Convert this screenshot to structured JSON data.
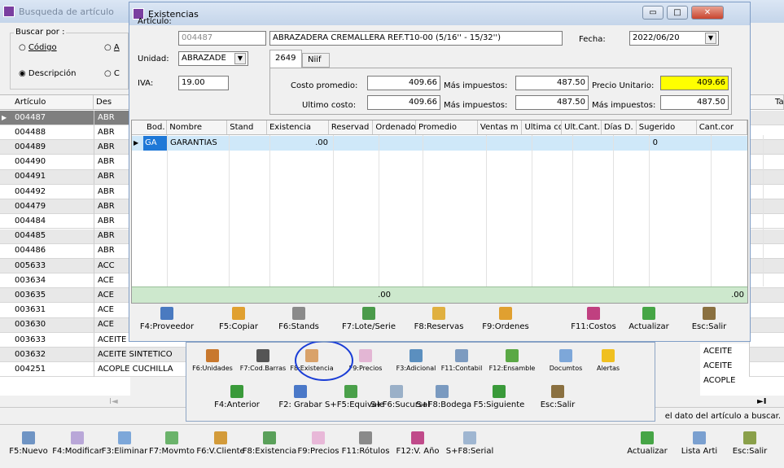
{
  "back_window": {
    "title": "Busqueda de artículo",
    "search_by_label": "Buscar por :",
    "radio_codigo": "Código",
    "radio_a": "A",
    "radio_descripcion": "Descripción",
    "radio_c": "C",
    "col_articulo": "Artículo",
    "col_des": "Des",
    "col_ta": "Ta",
    "rows": [
      {
        "code": "004487",
        "desc": "ABR",
        "extra": ""
      },
      {
        "code": "004488",
        "desc": "ABR",
        "extra": ""
      },
      {
        "code": "004489",
        "desc": "ABR",
        "extra": ""
      },
      {
        "code": "004490",
        "desc": "ABR",
        "extra": ""
      },
      {
        "code": "004491",
        "desc": "ABR",
        "extra": ""
      },
      {
        "code": "004492",
        "desc": "ABR",
        "extra": ""
      },
      {
        "code": "004479",
        "desc": "ABR",
        "extra": ""
      },
      {
        "code": "004484",
        "desc": "ABR",
        "extra": ""
      },
      {
        "code": "004485",
        "desc": "ABR",
        "extra": ""
      },
      {
        "code": "004486",
        "desc": "ABR",
        "extra": ""
      },
      {
        "code": "005633",
        "desc": "ACC",
        "extra": ""
      },
      {
        "code": "003634",
        "desc": "ACE",
        "extra": ""
      },
      {
        "code": "003635",
        "desc": "ACE",
        "extra": ""
      },
      {
        "code": "003631",
        "desc": "ACE",
        "extra": ""
      },
      {
        "code": "003630",
        "desc": "ACE",
        "extra": ""
      },
      {
        "code": "003633",
        "desc": "ACEITE CAPELLA W",
        "extra": "ACEITE"
      },
      {
        "code": "003632",
        "desc": "ACEITE SINTETICO",
        "extra": "ACEITE"
      },
      {
        "code": "004251",
        "desc": "ACOPLE CUCHILLA",
        "extra": "ACOPLE"
      }
    ],
    "nav_last": "►I",
    "nav_first": "I◄",
    "status_hint": "el dato del artículo a buscar."
  },
  "bottom_toolbar": [
    {
      "label": "F5:Nuevo",
      "color": "#6f94c4"
    },
    {
      "label": "F4:Modificar",
      "color": "#b9a7d8"
    },
    {
      "label": "F3:Eliminar",
      "color": "#7da7d9"
    },
    {
      "label": "F7:Movmto",
      "color": "#6bb36b"
    },
    {
      "label": "F6:V.Cliente",
      "color": "#d39b3a"
    },
    {
      "label": "F8:Existencia",
      "color": "#5aa05a"
    },
    {
      "label": "F9:Precios",
      "color": "#e8b8d8"
    },
    {
      "label": "F11:Rótulos",
      "color": "#8a8a8a"
    },
    {
      "label": "F12:V. Año",
      "color": "#c04a8a"
    },
    {
      "label": "S+F8:Serial",
      "color": "#9fb6d1"
    },
    {
      "label": "Actualizar",
      "color": "#46a546"
    },
    {
      "label": "Lista Arti",
      "color": "#7aa0d0"
    },
    {
      "label": "Esc:Salir",
      "color": "#8aa04a"
    }
  ],
  "middle_panel": {
    "row1": [
      {
        "label": "F6:Unidades",
        "color": "#c8782e"
      },
      {
        "label": "F7:Cod.Barras",
        "color": "#555555"
      },
      {
        "label": "F8:Existencia",
        "color": "#d9a26a"
      },
      {
        "label": "F9:Precios",
        "color": "#e3b6d4"
      },
      {
        "label": "F3:Adicional",
        "color": "#5b8fbf"
      },
      {
        "label": "F11:Contabil",
        "color": "#7d9bc0"
      },
      {
        "label": "F12:Ensamble",
        "color": "#5aa845"
      },
      {
        "label": "Documtos",
        "color": "#7da7d9"
      },
      {
        "label": "Alertas",
        "color": "#f0c020"
      }
    ],
    "row2": [
      {
        "label": "F4:Anterior",
        "color": "#3a9a3a"
      },
      {
        "label": "F2: Grabar",
        "color": "#4a78c8"
      },
      {
        "label": "S+F5:Equivale",
        "color": "#4aa04a"
      },
      {
        "label": "S+F6:Sucursal",
        "color": "#9ab0c8"
      },
      {
        "label": "S+F8:Bodega",
        "color": "#7a9ac0"
      },
      {
        "label": "F5:Siguiente",
        "color": "#3a9a3a"
      },
      {
        "label": "Esc:Salir",
        "color": "#8a7040"
      }
    ]
  },
  "existencias": {
    "title": "Existencias",
    "articulo_label": "Artículo:",
    "articulo_value": "004487",
    "description": "ABRAZADERA CREMALLERA REF.T10-00 (5/16'' - 15/32'')",
    "fecha_label": "Fecha:",
    "fecha_value": "2022/06/20",
    "unidad_label": "Unidad:",
    "unidad_value": "ABRAZADE",
    "tab_2649": "2649",
    "tab_niif": "Niif",
    "iva_label": "IVA:",
    "iva_value": "19.00",
    "costo_promedio_label": "Costo promedio:",
    "costo_promedio": "409.66",
    "mas_impuestos_label": "Más impuestos:",
    "costo_promedio_imp": "487.50",
    "precio_unitario_label": "Precio Unitario:",
    "precio_unitario": "409.66",
    "ultimo_costo_label": "Ultimo costo:",
    "ultimo_costo": "409.66",
    "ultimo_costo_imp": "487.50",
    "precio_imp": "487.50",
    "columns": [
      "Bod.",
      "Nombre",
      "Stand",
      "Existencia",
      "Reservad",
      "Ordenado",
      "Promedio",
      "Ventas m",
      "Ultima co",
      "Ult.Cant.",
      "Días D.",
      "Sugerido",
      "Cant.cor"
    ],
    "row": {
      "bod": "GA",
      "nombre": "GARANTIAS",
      "existencia": ".00",
      "dias": "0"
    },
    "total_existencia": ".00",
    "total_sugerido": ".00",
    "buttons": [
      {
        "label": "F4:Proveedor",
        "color": "#4a7ac0"
      },
      {
        "label": "F5:Copiar",
        "color": "#e0a030"
      },
      {
        "label": "F6:Stands",
        "color": "#8a8a8a"
      },
      {
        "label": "F7:Lote/Serie",
        "color": "#4a9a4a"
      },
      {
        "label": "F8:Reservas",
        "color": "#e0b040"
      },
      {
        "label": "F9:Ordenes",
        "color": "#e0a030"
      },
      {
        "label": "F11:Costos",
        "color": "#c04080"
      },
      {
        "label": "Actualizar",
        "color": "#46a546"
      },
      {
        "label": "Esc:Salir",
        "color": "#8a7040"
      }
    ]
  },
  "highlight_color": "#1a3dd6"
}
